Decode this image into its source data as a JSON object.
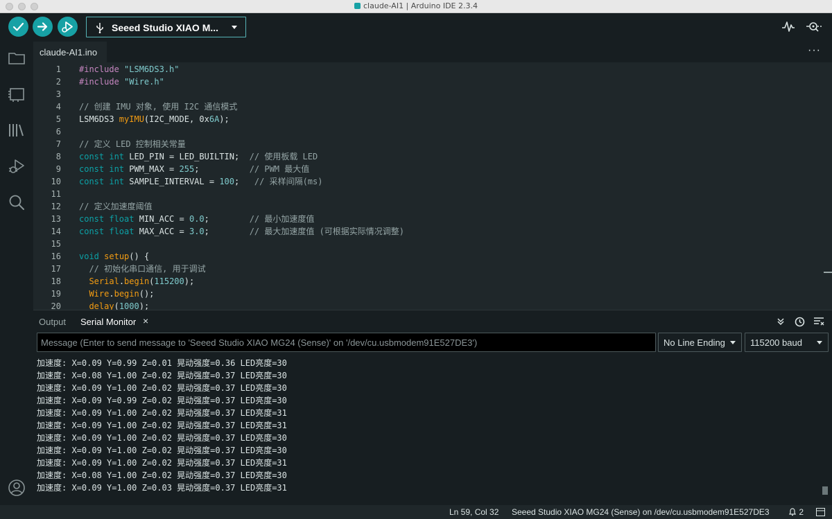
{
  "window": {
    "title": "claude-AI1 | Arduino IDE 2.3.4"
  },
  "toolbar": {
    "verify_icon": "checkmark-icon",
    "upload_icon": "arrow-right-icon",
    "debug_icon": "debug-icon",
    "board_label": "Seeed Studio XIAO M...",
    "accent_color": "#17a1a5"
  },
  "activity_bar": {
    "items": [
      "folder-icon",
      "board-manager-icon",
      "library-icon",
      "debug-icon",
      "search-icon"
    ],
    "bottom": "account-icon"
  },
  "editor": {
    "tab_label": "claude-AI1.ino",
    "lines": [
      {
        "n": "1",
        "tokens": [
          {
            "t": "#include",
            "c": "pp"
          },
          {
            "t": " ",
            "c": ""
          },
          {
            "t": "\"LSM6DS3.h\"",
            "c": "s"
          }
        ]
      },
      {
        "n": "2",
        "tokens": [
          {
            "t": "#include",
            "c": "pp"
          },
          {
            "t": " ",
            "c": ""
          },
          {
            "t": "\"Wire.h\"",
            "c": "s"
          }
        ]
      },
      {
        "n": "3",
        "tokens": []
      },
      {
        "n": "4",
        "tokens": [
          {
            "t": "// 创建 IMU 对象, 使用 I2C 通信模式",
            "c": "c"
          }
        ]
      },
      {
        "n": "5",
        "tokens": [
          {
            "t": "LSM6DS3 ",
            "c": ""
          },
          {
            "t": "myIMU",
            "c": "f"
          },
          {
            "t": "(I2C_MODE, 0x",
            "c": ""
          },
          {
            "t": "6A",
            "c": "n"
          },
          {
            "t": ");",
            "c": ""
          }
        ]
      },
      {
        "n": "6",
        "tokens": []
      },
      {
        "n": "7",
        "tokens": [
          {
            "t": "// 定义 LED 控制相关常量",
            "c": "c"
          }
        ]
      },
      {
        "n": "8",
        "tokens": [
          {
            "t": "const int",
            "c": "k"
          },
          {
            "t": " LED_PIN = LED_BUILTIN;  ",
            "c": ""
          },
          {
            "t": "// 使用板载 LED",
            "c": "c"
          }
        ]
      },
      {
        "n": "9",
        "tokens": [
          {
            "t": "const int",
            "c": "k"
          },
          {
            "t": " PWM_MAX = ",
            "c": ""
          },
          {
            "t": "255",
            "c": "n"
          },
          {
            "t": ";          ",
            "c": ""
          },
          {
            "t": "// PWM 最大值",
            "c": "c"
          }
        ]
      },
      {
        "n": "10",
        "tokens": [
          {
            "t": "const int",
            "c": "k"
          },
          {
            "t": " SAMPLE_INTERVAL = ",
            "c": ""
          },
          {
            "t": "100",
            "c": "n"
          },
          {
            "t": ";   ",
            "c": ""
          },
          {
            "t": "// 采样间隔(ms)",
            "c": "c"
          }
        ]
      },
      {
        "n": "11",
        "tokens": []
      },
      {
        "n": "12",
        "tokens": [
          {
            "t": "// 定义加速度阈值",
            "c": "c"
          }
        ]
      },
      {
        "n": "13",
        "tokens": [
          {
            "t": "const float",
            "c": "k"
          },
          {
            "t": " MIN_ACC = ",
            "c": ""
          },
          {
            "t": "0.0",
            "c": "n"
          },
          {
            "t": ";        ",
            "c": ""
          },
          {
            "t": "// 最小加速度值",
            "c": "c"
          }
        ]
      },
      {
        "n": "14",
        "tokens": [
          {
            "t": "const float",
            "c": "k"
          },
          {
            "t": " MAX_ACC = ",
            "c": ""
          },
          {
            "t": "3.0",
            "c": "n"
          },
          {
            "t": ";        ",
            "c": ""
          },
          {
            "t": "// 最大加速度值 (可根据实际情况调整)",
            "c": "c"
          }
        ]
      },
      {
        "n": "15",
        "tokens": []
      },
      {
        "n": "16",
        "tokens": [
          {
            "t": "void",
            "c": "k"
          },
          {
            "t": " ",
            "c": ""
          },
          {
            "t": "setup",
            "c": "f"
          },
          {
            "t": "() {",
            "c": ""
          }
        ]
      },
      {
        "n": "17",
        "tokens": [
          {
            "t": "  // 初始化串口通信, 用于调试",
            "c": "c"
          }
        ]
      },
      {
        "n": "18",
        "tokens": [
          {
            "t": "  ",
            "c": ""
          },
          {
            "t": "Serial",
            "c": "f"
          },
          {
            "t": ".",
            "c": ""
          },
          {
            "t": "begin",
            "c": "f"
          },
          {
            "t": "(",
            "c": ""
          },
          {
            "t": "115200",
            "c": "n"
          },
          {
            "t": ");",
            "c": ""
          }
        ]
      },
      {
        "n": "19",
        "tokens": [
          {
            "t": "  ",
            "c": ""
          },
          {
            "t": "Wire",
            "c": "f"
          },
          {
            "t": ".",
            "c": ""
          },
          {
            "t": "begin",
            "c": "f"
          },
          {
            "t": "();",
            "c": ""
          }
        ]
      },
      {
        "n": "20",
        "tokens": [
          {
            "t": "  ",
            "c": ""
          },
          {
            "t": "delay",
            "c": "f"
          },
          {
            "t": "(",
            "c": ""
          },
          {
            "t": "1000",
            "c": "n"
          },
          {
            "t": ");",
            "c": ""
          }
        ]
      }
    ]
  },
  "panel": {
    "tab_output": "Output",
    "tab_serial_monitor": "Serial Monitor",
    "close_glyph": "×",
    "message_placeholder": "Message (Enter to send message to 'Seeed Studio XIAO MG24 (Sense)' on '/dev/cu.usbmodem91E527DE3')",
    "line_ending": "No Line Ending",
    "baud": "115200 baud",
    "serial_lines": [
      "加速度: X=0.09 Y=0.99 Z=0.01 晃动强度=0.36 LED亮度=30",
      "加速度: X=0.08 Y=1.00 Z=0.02 晃动强度=0.37 LED亮度=30",
      "加速度: X=0.09 Y=1.00 Z=0.02 晃动强度=0.37 LED亮度=30",
      "加速度: X=0.09 Y=0.99 Z=0.02 晃动强度=0.37 LED亮度=30",
      "加速度: X=0.09 Y=1.00 Z=0.02 晃动强度=0.37 LED亮度=31",
      "加速度: X=0.09 Y=1.00 Z=0.02 晃动强度=0.37 LED亮度=31",
      "加速度: X=0.09 Y=1.00 Z=0.02 晃动强度=0.37 LED亮度=30",
      "加速度: X=0.09 Y=1.00 Z=0.02 晃动强度=0.37 LED亮度=30",
      "加速度: X=0.09 Y=1.00 Z=0.02 晃动强度=0.37 LED亮度=31",
      "加速度: X=0.08 Y=1.00 Z=0.02 晃动强度=0.37 LED亮度=30",
      "加速度: X=0.09 Y=1.00 Z=0.03 晃动强度=0.37 LED亮度=31"
    ]
  },
  "status": {
    "position": "Ln 59, Col 32",
    "board_port": "Seeed Studio XIAO MG24 (Sense) on /dev/cu.usbmodem91E527DE3",
    "notifications": "2"
  }
}
